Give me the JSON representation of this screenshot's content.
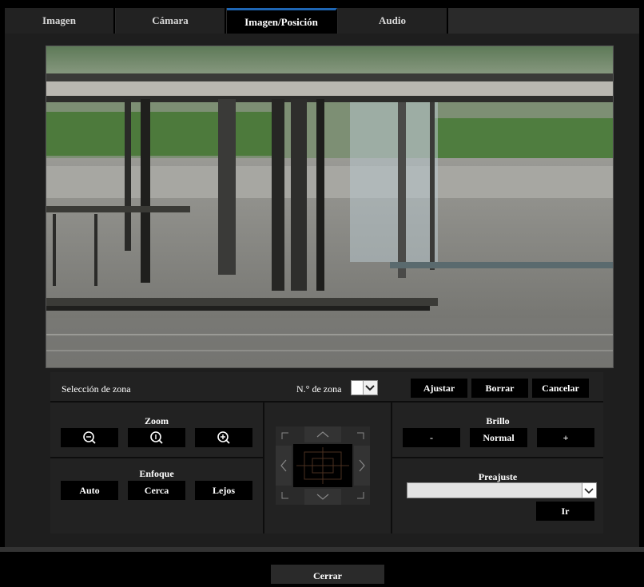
{
  "tabs": [
    {
      "label": "Imagen"
    },
    {
      "label": "Cámara"
    },
    {
      "label": "Imagen/Posición"
    },
    {
      "label": "Audio"
    }
  ],
  "active_tab": "Imagen/Posición",
  "zone_row": {
    "label": "Selección de zona",
    "zone_number_label": "N.° de zona",
    "zone_number_value": "",
    "set_button": "Ajustar",
    "delete_button": "Borrar",
    "cancel_button": "Cancelar"
  },
  "zoom": {
    "title": "Zoom",
    "icons": [
      "zoom-out-icon",
      "zoom-reset-icon",
      "zoom-in-icon"
    ]
  },
  "focus": {
    "title": "Enfoque",
    "auto_button": "Auto",
    "near_button": "Cerca",
    "far_button": "Lejos"
  },
  "brightness": {
    "title": "Brillo",
    "minus_button": "-",
    "normal_button": "Normal",
    "plus_button": "+"
  },
  "preset": {
    "title": "Preajuste",
    "selected": "",
    "go_button": "Ir"
  },
  "close_button": "Cerrar",
  "colors": {
    "active_tab_accent": "#1e66b4",
    "background": "#000000",
    "panel": "#222222"
  }
}
